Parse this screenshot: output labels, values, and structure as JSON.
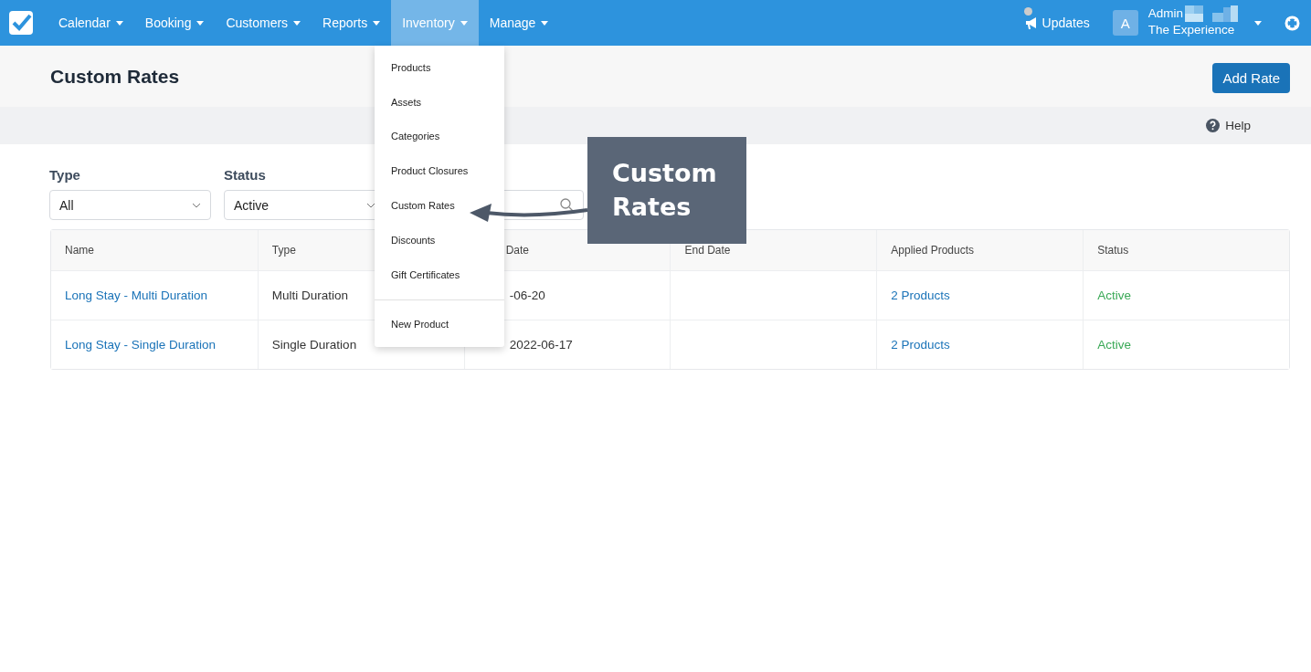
{
  "nav": {
    "items": [
      {
        "label": "Calendar",
        "selected": false
      },
      {
        "label": "Booking",
        "selected": false
      },
      {
        "label": "Customers",
        "selected": false
      },
      {
        "label": "Reports",
        "selected": false
      },
      {
        "label": "Inventory",
        "selected": true
      },
      {
        "label": "Manage",
        "selected": false
      }
    ],
    "updates": "Updates",
    "avatar": "A",
    "user_name": "Admin",
    "account": "The Experience"
  },
  "page": {
    "title": "Custom Rates",
    "add_button": "Add Rate",
    "help": "Help"
  },
  "filters": [
    {
      "label": "Type",
      "value": "All"
    },
    {
      "label": "Status",
      "value": "Active"
    }
  ],
  "table": {
    "columns": [
      "Name",
      "Type",
      "Date",
      "End Date",
      "Applied Products",
      "Status"
    ],
    "rows": [
      [
        "Long Stay - Multi Duration",
        "Multi Duration",
        "-06-20",
        "",
        "2 Products",
        "Active"
      ],
      [
        "Long Stay - Single Duration",
        "Single Duration",
        "2022-06-17",
        "",
        "2 Products",
        "Active"
      ]
    ]
  },
  "menu": {
    "items": [
      {
        "label": "Products",
        "kind": "item"
      },
      {
        "label": "Assets",
        "kind": "item"
      },
      {
        "label": "Categories",
        "kind": "item"
      },
      {
        "label": "Product Closures",
        "kind": "item"
      },
      {
        "label": "Custom Rates",
        "kind": "item"
      },
      {
        "label": "Discounts",
        "kind": "item"
      },
      {
        "label": "Gift Certificates",
        "kind": "item"
      },
      {
        "kind": "divider"
      },
      {
        "label": "New Product",
        "kind": "item"
      }
    ]
  },
  "callout": {
    "text": "Custom Rates"
  }
}
